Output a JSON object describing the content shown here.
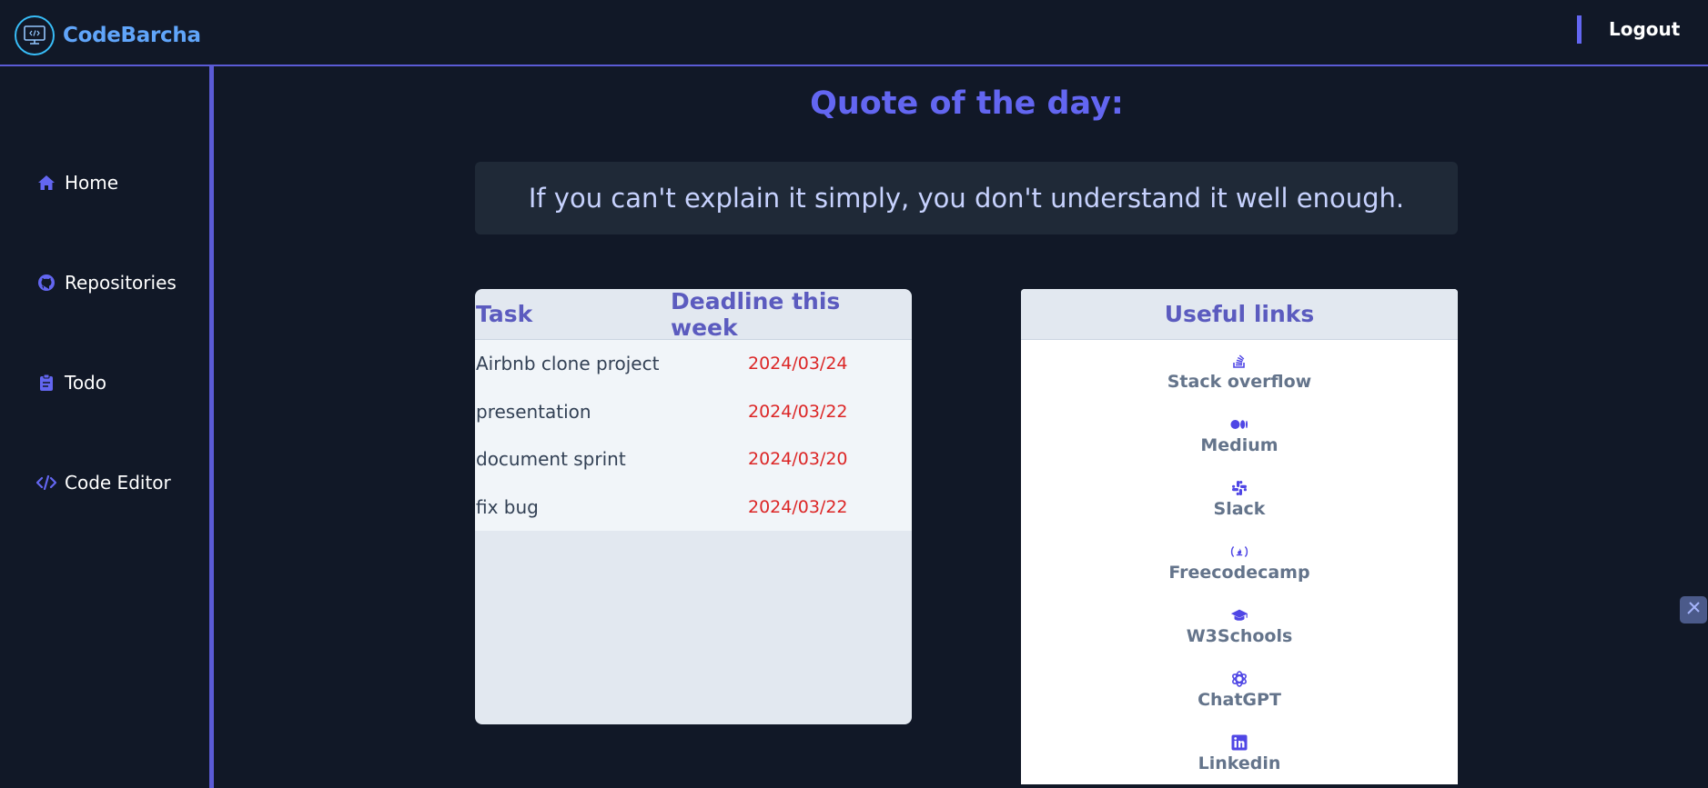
{
  "app": {
    "name": "CodeBarcha"
  },
  "header": {
    "logout_label": "Logout"
  },
  "sidebar": {
    "items": [
      {
        "label": "Home",
        "icon": "home-icon"
      },
      {
        "label": "Repositories",
        "icon": "github-icon"
      },
      {
        "label": "Todo",
        "icon": "clipboard-icon"
      },
      {
        "label": "Code Editor",
        "icon": "code-icon"
      }
    ]
  },
  "main": {
    "quote_title": "Quote of the day:",
    "quote_text": "If you can't explain it simply, you don't understand it well enough."
  },
  "tasks": {
    "headers": {
      "task": "Task",
      "deadline": "Deadline this week"
    },
    "rows": [
      {
        "task": "Airbnb clone project",
        "deadline": "2024/03/24"
      },
      {
        "task": "presentation",
        "deadline": "2024/03/22"
      },
      {
        "task": "document sprint",
        "deadline": "2024/03/20"
      },
      {
        "task": "fix bug",
        "deadline": "2024/03/22"
      }
    ]
  },
  "links": {
    "title": "Useful links",
    "items": [
      {
        "label": "Stack overflow",
        "icon": "stackoverflow-icon"
      },
      {
        "label": "Medium",
        "icon": "medium-icon"
      },
      {
        "label": "Slack",
        "icon": "slack-icon"
      },
      {
        "label": "Freecodecamp",
        "icon": "freecodecamp-icon"
      },
      {
        "label": "W3Schools",
        "icon": "graduation-cap-icon"
      },
      {
        "label": "ChatGPT",
        "icon": "openai-icon"
      },
      {
        "label": "Linkedin",
        "icon": "linkedin-icon"
      }
    ]
  },
  "colors": {
    "accent": "#6366f1",
    "background": "#111827",
    "deadline": "#dc2626"
  }
}
